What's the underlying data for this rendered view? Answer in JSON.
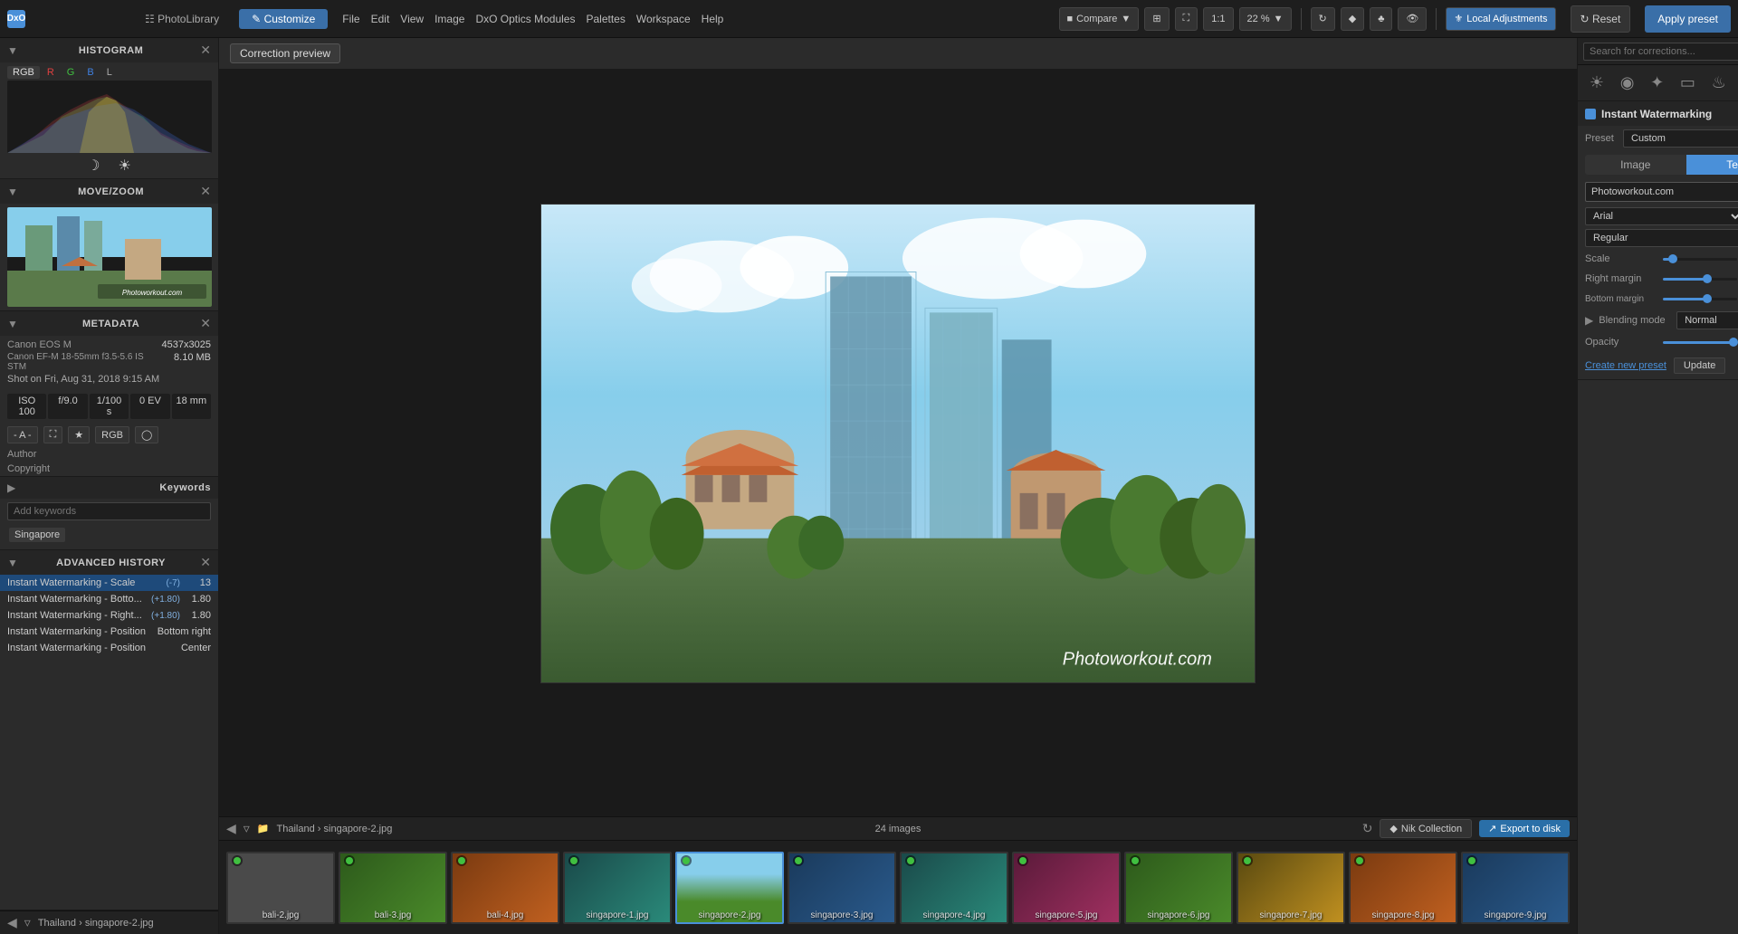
{
  "app": {
    "title": "DxO",
    "logo": "DxO",
    "tabs": [
      {
        "label": "PhotoLibrary",
        "active": false
      },
      {
        "label": "Customize",
        "active": true
      }
    ],
    "menu": [
      "File",
      "Edit",
      "View",
      "Image",
      "DxO Optics Modules",
      "Palettes",
      "Workspace",
      "Help"
    ],
    "toolbar": {
      "compare": "Compare",
      "zoom_1to1": "1:1",
      "zoom_level": "22 %",
      "local_adjustments": "Local Adjustments",
      "reset_label": "Reset",
      "apply_preset_label": "Apply preset"
    }
  },
  "correction_preview": {
    "label": "Correction preview"
  },
  "histogram": {
    "title": "HISTOGRAM",
    "tabs": [
      "RGB",
      "R",
      "G",
      "B",
      "L"
    ],
    "active_tab": "RGB"
  },
  "move_zoom": {
    "title": "MOVE/ZOOM"
  },
  "metadata": {
    "title": "METADATA",
    "camera": "Canon EOS M",
    "dimensions": "4537x3025",
    "lens": "Canon EF-M 18-55mm f3.5-5.6 IS STM",
    "file_size": "8.10 MB",
    "shot_date": "Shot on Fri, Aug 31, 2018 9:15 AM",
    "iso": "ISO 100",
    "aperture": "f/9.0",
    "shutter": "1/100 s",
    "ev": "0 EV",
    "focal": "18 mm",
    "color_mode": "RGB",
    "author_label": "Author",
    "author_val": "",
    "copyright_label": "Copyright",
    "copyright_val": ""
  },
  "keywords": {
    "title": "Keywords",
    "placeholder": "Add keywords",
    "tags": [
      "Singapore"
    ]
  },
  "history": {
    "title": "ADVANCED HISTORY",
    "items": [
      {
        "name": "Instant Watermarking - Scale",
        "delta": "(-7)",
        "val": "13",
        "active": true
      },
      {
        "name": "Instant Watermarking - Botto...",
        "delta": "(+1.80)",
        "val": "1.80"
      },
      {
        "name": "Instant Watermarking - Right...",
        "delta": "(+1.80)",
        "val": "1.80"
      },
      {
        "name": "Instant Watermarking - Position",
        "delta": "",
        "val": "Bottom right"
      },
      {
        "name": "Instant Watermarking - Position",
        "delta": "",
        "val": "Center"
      }
    ]
  },
  "right_panel": {
    "search_placeholder": "Search for corrections...",
    "tools": [
      "light",
      "color",
      "detail",
      "geometry",
      "effects",
      "local",
      "fx"
    ],
    "watermark": {
      "title": "Instant Watermarking",
      "enabled": true,
      "preset_label": "Preset",
      "preset_value": "Custom",
      "tab_image": "Image",
      "tab_text": "Text",
      "active_tab": "Text",
      "text_value": "Photoworkout.com",
      "font": "Arial",
      "style": "Regular",
      "scale_label": "Scale",
      "scale_value": "13",
      "scale_pct": 13,
      "right_margin_label": "Right margin",
      "right_margin_value": "1.80",
      "right_margin_pct": 60,
      "bottom_margin_label": "Bottom margin",
      "bottom_margin_value": "1.80",
      "bottom_margin_pct": 60,
      "blending_label": "Blending mode",
      "blending_value": "Normal",
      "opacity_label": "Opacity",
      "opacity_value": "100",
      "opacity_pct": 95,
      "create_preset": "Create new preset",
      "update": "Update"
    }
  },
  "filmstrip": {
    "image_count": "24 images",
    "breadcrumb_parts": [
      "Thailand",
      "singapore-2.jpg"
    ],
    "nik_collection": "Nik Collection",
    "export_to_disk": "Export to disk",
    "thumbs": [
      {
        "label": "bali-2.jpg",
        "color": "gray",
        "selected": false
      },
      {
        "label": "bali-3.jpg",
        "color": "green",
        "selected": false
      },
      {
        "label": "bali-4.jpg",
        "color": "orange",
        "selected": false
      },
      {
        "label": "singapore-1.jpg",
        "color": "teal",
        "selected": false
      },
      {
        "label": "singapore-2.jpg",
        "color": "singapore",
        "selected": true
      },
      {
        "label": "singapore-3.jpg",
        "color": "blue",
        "selected": false
      },
      {
        "label": "singapore-4.jpg",
        "color": "teal",
        "selected": false
      },
      {
        "label": "singapore-5.jpg",
        "color": "pink",
        "selected": false
      },
      {
        "label": "singapore-6.jpg",
        "color": "green",
        "selected": false
      },
      {
        "label": "singapore-7.jpg",
        "color": "yellow",
        "selected": false
      },
      {
        "label": "singapore-8.jpg",
        "color": "orange",
        "selected": false
      },
      {
        "label": "singapore-9.jpg",
        "color": "blue",
        "selected": false
      }
    ]
  },
  "main_image": {
    "watermark_text": "Photoworkout.com"
  }
}
